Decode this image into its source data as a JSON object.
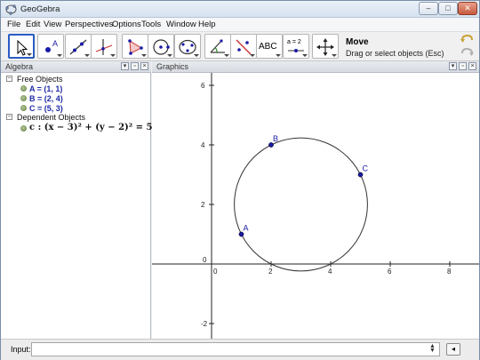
{
  "window": {
    "title": "GeoGebra"
  },
  "menu": [
    "File",
    "Edit",
    "View",
    "Perspectives",
    "Options",
    "Tools",
    "Window",
    "Help"
  ],
  "toolbar": {
    "active_tool_name": "Move",
    "active_tool_desc": "Drag or select objects (Esc)",
    "tools": [
      "move-tool",
      "point-tool",
      "line-tool",
      "perpendicular-line-tool",
      "polygon-tool",
      "circle-tool",
      "conic-tool",
      "angle-tool",
      "reflect-tool",
      "text-tool",
      "slider-tool",
      "move-graphics-tool"
    ],
    "text_tool_label": "ABC",
    "slider_label": "a = 2"
  },
  "algebra": {
    "title": "Algebra",
    "free_objects_label": "Free Objects",
    "free_objects": [
      "A = (1, 1)",
      "B = (2, 4)",
      "C = (5, 3)"
    ],
    "dependent_objects_label": "Dependent Objects",
    "dependent_objects": [
      "c : (x − 3)² + (y − 2)² = 5"
    ]
  },
  "graphics": {
    "title": "Graphics",
    "x_ticks": [
      "0",
      "2",
      "4",
      "6",
      "8"
    ],
    "y_ticks": [
      "6",
      "4",
      "2",
      "0",
      "-2"
    ],
    "points": [
      {
        "name": "A",
        "x": 1,
        "y": 1
      },
      {
        "name": "B",
        "x": 2,
        "y": 4
      },
      {
        "name": "C",
        "x": 5,
        "y": 3
      }
    ],
    "circle": {
      "name": "c",
      "cx": 3,
      "cy": 2,
      "r2": 5
    },
    "point_color": "#1a1aa6"
  },
  "input": {
    "label": "Input:",
    "value": ""
  }
}
